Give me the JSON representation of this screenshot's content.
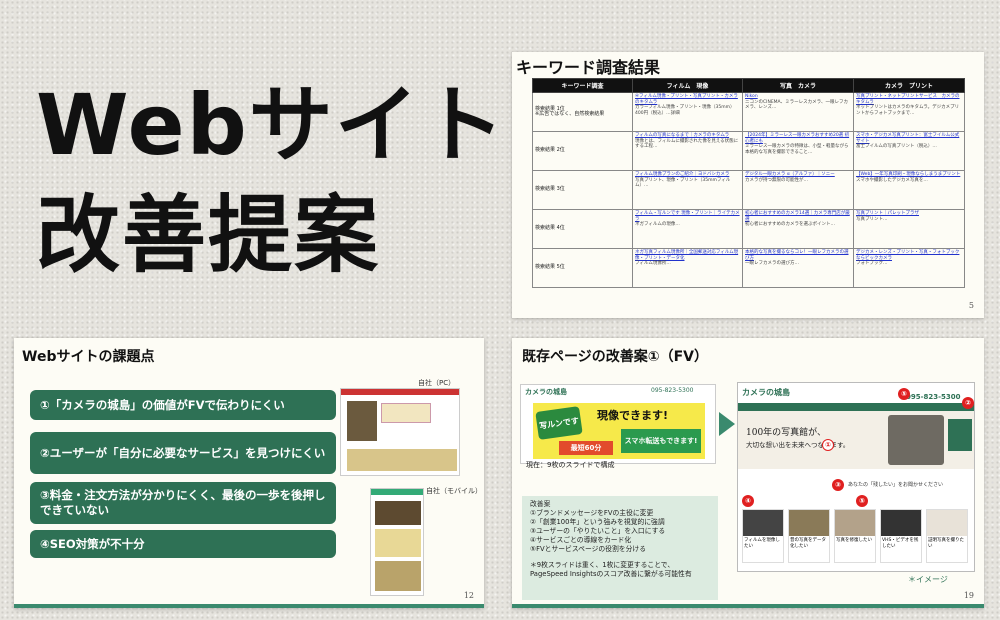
{
  "hero": {
    "line1": "Webサイト",
    "line2": "改善提案"
  },
  "slide1": {
    "title": "キーワード調査結果",
    "page": "5",
    "headers": [
      "キーワード調査",
      "フィルム　現像",
      "写真　カメラ",
      "カメラ　プリント"
    ],
    "rows": [
      {
        "key": "検索結果 1位\n※広告ではなく、自然検索結果",
        "c1_link": "④フィルム現像・プリント・写真プリント・カメラのキタムラ",
        "c1_text": "カラーフィルム現像・プリント・現像（35mm）400円（税込）…詳細",
        "c2_link": "Nikon",
        "c2_text": "ニコンのCINEMA、ミラーレスカメラ、一眼レフカメラ、レンズ…",
        "c3_link": "写真プリント・ネットプリントサービス　カメラのキタムラ",
        "c3_text": "ネットプリントはカメラのキタムラ。デジカメプリントからフォトブックまで…"
      },
      {
        "key": "検索結果 2位",
        "c1_link": "フィルムの写真になるまで｜カメラのキタムラ",
        "c1_text": "現像とは、フィルムに撮影された像を見える状態にする工程…",
        "c2_link": "【2024年】ミラーレス一眼カメラおすすめ20選 初心者にも",
        "c2_text": "ミラーレス一眼カメラの特徴は、小型・軽量ながら本格的な写真を撮影できること…",
        "c3_link": "スマホ・デジカメ写真プリント：富士フイルム公式サイト",
        "c3_text": "富士フイルムの写真プリント（税込）…"
      },
      {
        "key": "検索結果 3位",
        "c1_link": "フィルム現像プランのご紹介｜ヨドバシカメラ",
        "c1_text": "写真プリント、現像・プリント（35mmフィルム）…",
        "c2_link": "デジタル一眼カメラ α（アルファ）｜ソニー",
        "c2_text": "カメラが持つ無限の可能性が…",
        "c3_link": "【Web】一年写真印刷・現像ならしまうまプリント",
        "c3_text": "スマホや撮影したデジカメ写真を…"
      },
      {
        "key": "検索結果 4位",
        "c1_link": "フィルム・写ルンです 現像・プリント｜ライテカメラ",
        "c1_text": "ネガフィルムの現像…",
        "c2_link": "初心者におすすめのカメラ14選｜カメラ専門店が厳選",
        "c2_text": "初心者におすすめのカメラを選ぶポイント…",
        "c3_link": "写真プリント｜パレットプラザ",
        "c3_text": "写真プリント…"
      },
      {
        "key": "検索結果 5位",
        "c1_link": "ネガ写真フィルム現像所｜全国郵送対応フィルム現像・プリント・データ化",
        "c1_text": "フィルム現像所…",
        "c2_link": "本格的な写真を撮るならコレ！一眼レフカメラの選び方",
        "c2_text": "一眼レフカメラの選び方…",
        "c3_link": "デジカメ・レンズ・プリント・写真・フォトブックならビックカメラ",
        "c3_text": "フォトブック…"
      }
    ]
  },
  "slide2": {
    "title": "Webサイトの課題点",
    "issues": [
      "①「カメラの城島」の価値がFVで伝わりにくい",
      "②ユーザーが「自分に必要なサービス」を見つけにくい",
      "③料金・注文方法が分かりにくく、最後の一歩を後押しできていない",
      "④SEO対策が不十分"
    ],
    "label_pc": "自社（PC）",
    "label_mobile": "自社（モバイル）",
    "page": "12"
  },
  "slide3": {
    "title": "既存ページの改善案①（FV）",
    "old_shop": "カメラの城島",
    "old_phone": "095-823-5300",
    "banner1": "写ルンです",
    "banner2": "現像できます!",
    "banner3": "最短60分",
    "banner4": "スマホ転送もできます!",
    "current": "現在：9枚のスライドで構成",
    "proposal_title": "改善案",
    "proposals": [
      "①ブランドメッセージをFVの主役に変更",
      "②「創業100年」という強みを視覚的に強調",
      "③ユーザーの「やりたいこと」を入口にする",
      "④サービスごとの導線をカード化",
      "⑤FVとサービスページの役割を分ける"
    ],
    "note1": "＊9枚スライドは重く、1枚に変更することで、",
    "note2": "PageSpeed Insightsのスコア改善に繋がる可能性有",
    "new_shop": "カメラの城島",
    "new_phone": "095-823-5300",
    "catch1": "100年の写真館が、",
    "catch2": "大切な想い出を未来へつなぎます。",
    "ask": "あなたの「残したい」をお聞かせください",
    "cards": [
      "フィルムを現像したい",
      "昔の写真をデータ化したい",
      "写真を修復したい",
      "VHS・ビデオを残したい",
      "証明写真を撮りたい"
    ],
    "image_note": "＊イメージ",
    "page": "19"
  },
  "colors": {
    "accent_green": "#2e7155",
    "link_blue": "#2233cc",
    "mark_red": "#e02020"
  }
}
